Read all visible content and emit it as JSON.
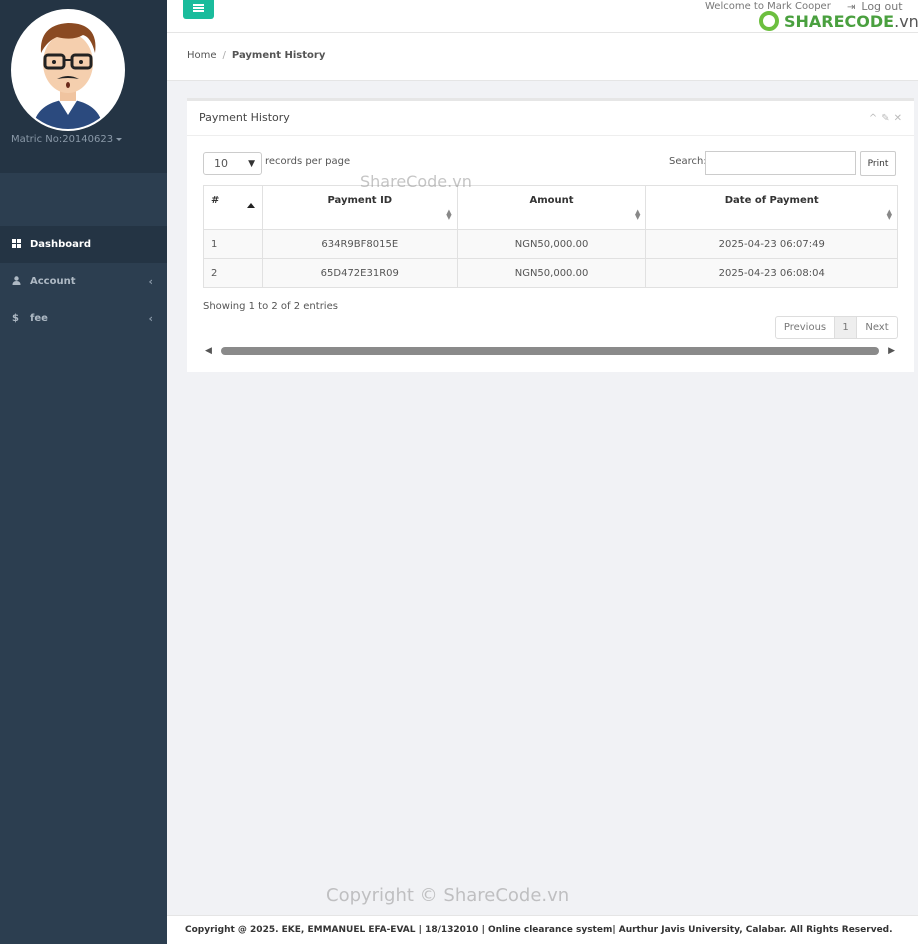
{
  "sidebar": {
    "matric": "Matric No:20140623",
    "items": [
      {
        "label": "Dashboard",
        "icon": "grid-icon"
      },
      {
        "label": "Account",
        "icon": "user-icon"
      },
      {
        "label": "fee",
        "icon": "dollar-icon"
      }
    ]
  },
  "topbar": {
    "welcome": "Welcome to Mark Cooper",
    "logout": "Log out",
    "logo_brand": "SHARECODE",
    "logo_suffix": ".vn"
  },
  "breadcrumb": {
    "home": "Home",
    "separator": "/",
    "current": "Payment History"
  },
  "panel": {
    "title": "Payment History",
    "length_value": "10",
    "length_label": "records per page",
    "search_label": "Search:",
    "search_value": "",
    "print_label": "Print",
    "columns": [
      "#",
      "Payment ID",
      "Amount",
      "Date of Payment"
    ],
    "rows": [
      {
        "num": "1",
        "payment_id": "634R9BF8015E",
        "amount": "NGN50,000.00",
        "date": "2025-04-23 06:07:49"
      },
      {
        "num": "2",
        "payment_id": "65D472E31R09",
        "amount": "NGN50,000.00",
        "date": "2025-04-23 06:08:04"
      }
    ],
    "info": "Showing 1 to 2 of 2 entries",
    "pager": {
      "prev": "Previous",
      "page": "1",
      "next": "Next"
    }
  },
  "watermarks": {
    "top": "ShareCode.vn",
    "bottom": "Copyright © ShareCode.vn"
  },
  "footer": {
    "text": "Copyright @ 2025. EKE, EMMANUEL EFA-EVAL | 18/132010 | Online clearance system| Aurthur Javis University, Calabar. All Rights Reserved."
  },
  "colors": {
    "sidebar": "#2c3e50",
    "accent": "#1abc9c",
    "logo_green": "#4aa03f"
  }
}
